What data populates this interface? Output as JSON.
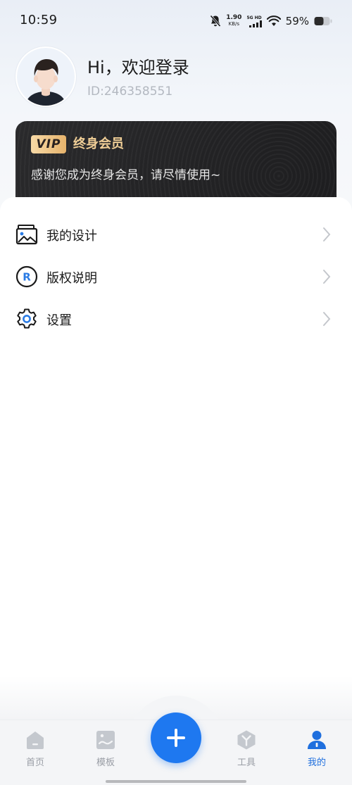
{
  "status_bar": {
    "time": "10:59",
    "net_speed_value": "1.90",
    "net_speed_unit": "KB/s",
    "network_label": "5G HD",
    "battery": "59%"
  },
  "profile": {
    "greeting": "Hi，欢迎登录",
    "user_id": "ID:246358551"
  },
  "vip": {
    "badge": "VIP",
    "title": "终身会员",
    "description": "感谢您成为终身会员，请尽情使用~",
    "colors": {
      "badge_gold": "#e6b36c",
      "title_gold": "#f1cf97",
      "card_bg": "#232325"
    }
  },
  "menu": {
    "items": [
      {
        "label": "我的设计",
        "icon": "image-frame-icon"
      },
      {
        "label": "版权说明",
        "icon": "registered-icon"
      },
      {
        "label": "设置",
        "icon": "gear-icon"
      }
    ]
  },
  "bottom_nav": {
    "items": [
      {
        "label": "首页",
        "icon": "home-icon",
        "active": false
      },
      {
        "label": "模板",
        "icon": "template-icon",
        "active": false
      },
      {
        "label": "工具",
        "icon": "tools-icon",
        "active": false
      },
      {
        "label": "我的",
        "icon": "profile-icon",
        "active": true
      }
    ],
    "fab_icon": "plus-icon",
    "accent_color": "#1e78f0"
  }
}
